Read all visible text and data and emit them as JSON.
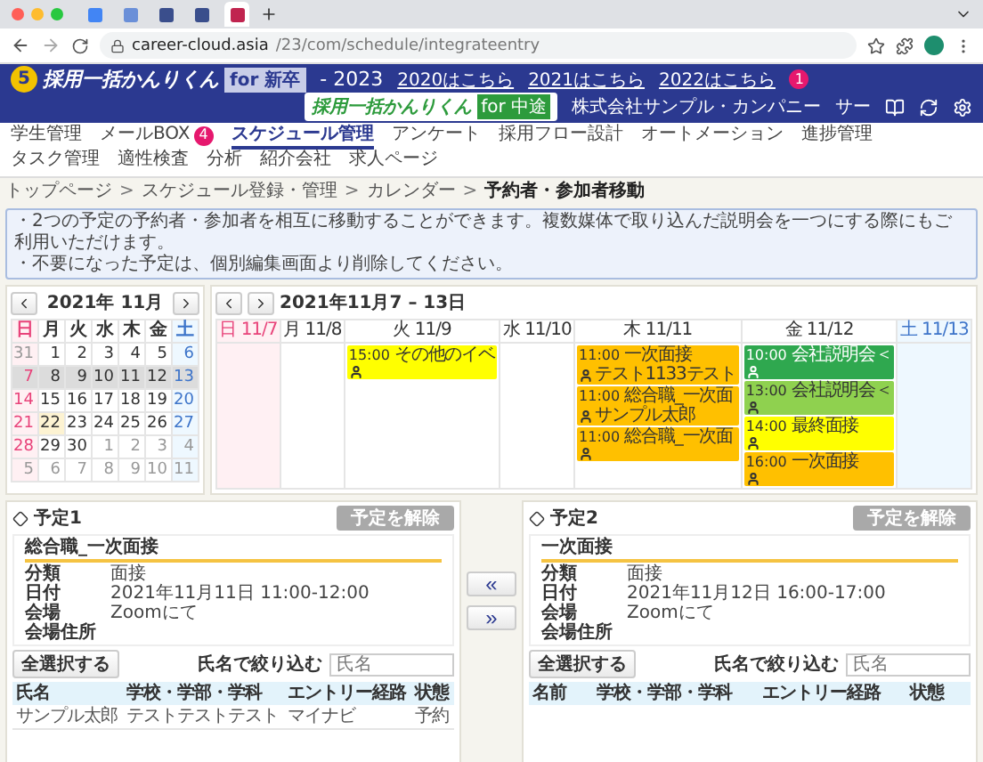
{
  "browser": {
    "tabs": [
      {
        "selected": false
      },
      {
        "selected": false
      },
      {
        "selected": false
      },
      {
        "selected": false
      },
      {
        "selected": true
      }
    ],
    "url_host": "career-cloud.asia",
    "url_path": "/23/com/schedule/integrateentry"
  },
  "header": {
    "logo_badge": "5",
    "logo": "採用一括かんりくん",
    "logo_tag": "for 新卒",
    "year": "- 2023",
    "links": [
      "2020はこちら",
      "2021はこちら",
      "2022はこちら"
    ],
    "links_badge": "1",
    "logo2": "採用一括かんりくん",
    "logo2_tag": "for 中途",
    "company": "株式会社サンプル・カンパニー",
    "user": "サー"
  },
  "nav": {
    "items": [
      {
        "label": "学生管理",
        "selected": false
      },
      {
        "label": "メールBOX",
        "selected": false,
        "badge": "4"
      },
      {
        "label": "スケジュール管理",
        "selected": true
      },
      {
        "label": "アンケート",
        "selected": false
      },
      {
        "label": "採用フロー設計",
        "selected": false
      },
      {
        "label": "オートメーション",
        "selected": false
      },
      {
        "label": "進捗管理",
        "selected": false
      },
      {
        "label": "タスク管理",
        "selected": false
      },
      {
        "label": "適性検査",
        "selected": false
      },
      {
        "label": "分析",
        "selected": false
      },
      {
        "label": "紹介会社",
        "selected": false
      },
      {
        "label": "求人ページ",
        "selected": false
      }
    ]
  },
  "breadcrumb": {
    "separator": ">",
    "items": [
      "トップページ",
      "スケジュール登録・管理",
      "カレンダー",
      "予約者・参加者移動"
    ]
  },
  "notice": [
    "・2つの予定の予約者・参加者を相互に移動することができます。複数媒体で取り込んだ説明会を一つにする際にもご利用いただけます。",
    "・不要になった予定は、個別編集画面より削除してください。"
  ],
  "month_calendar": {
    "title": "2021年 11月",
    "weekdays": [
      {
        "label": "日",
        "kind": "sunday"
      },
      {
        "label": "月",
        "kind": "weekday"
      },
      {
        "label": "火",
        "kind": "weekday"
      },
      {
        "label": "水",
        "kind": "weekday"
      },
      {
        "label": "木",
        "kind": "weekday"
      },
      {
        "label": "金",
        "kind": "weekday"
      },
      {
        "label": "土",
        "kind": "saturday"
      }
    ],
    "weeks": [
      {
        "selected": false,
        "days": [
          {
            "day": "31",
            "other_month": true,
            "today": false
          },
          {
            "day": "1",
            "other_month": false,
            "today": false
          },
          {
            "day": "2",
            "other_month": false,
            "today": false
          },
          {
            "day": "3",
            "other_month": false,
            "today": false
          },
          {
            "day": "4",
            "other_month": false,
            "today": false
          },
          {
            "day": "5",
            "other_month": false,
            "today": false
          },
          {
            "day": "6",
            "other_month": false,
            "today": false
          }
        ]
      },
      {
        "selected": true,
        "days": [
          {
            "day": "7",
            "other_month": false,
            "today": false
          },
          {
            "day": "8",
            "other_month": false,
            "today": false
          },
          {
            "day": "9",
            "other_month": false,
            "today": false
          },
          {
            "day": "10",
            "other_month": false,
            "today": false
          },
          {
            "day": "11",
            "other_month": false,
            "today": false
          },
          {
            "day": "12",
            "other_month": false,
            "today": false
          },
          {
            "day": "13",
            "other_month": false,
            "today": false
          }
        ]
      },
      {
        "selected": false,
        "days": [
          {
            "day": "14",
            "other_month": false,
            "today": false
          },
          {
            "day": "15",
            "other_month": false,
            "today": false
          },
          {
            "day": "16",
            "other_month": false,
            "today": false
          },
          {
            "day": "17",
            "other_month": false,
            "today": false
          },
          {
            "day": "18",
            "other_month": false,
            "today": false
          },
          {
            "day": "19",
            "other_month": false,
            "today": false
          },
          {
            "day": "20",
            "other_month": false,
            "today": false
          }
        ]
      },
      {
        "selected": false,
        "days": [
          {
            "day": "21",
            "other_month": false,
            "today": false
          },
          {
            "day": "22",
            "other_month": false,
            "today": true
          },
          {
            "day": "23",
            "other_month": false,
            "today": false
          },
          {
            "day": "24",
            "other_month": false,
            "today": false
          },
          {
            "day": "25",
            "other_month": false,
            "today": false
          },
          {
            "day": "26",
            "other_month": false,
            "today": false
          },
          {
            "day": "27",
            "other_month": false,
            "today": false
          }
        ]
      },
      {
        "selected": false,
        "days": [
          {
            "day": "28",
            "other_month": false,
            "today": false
          },
          {
            "day": "29",
            "other_month": false,
            "today": false
          },
          {
            "day": "30",
            "other_month": false,
            "today": false
          },
          {
            "day": "1",
            "other_month": true,
            "today": false
          },
          {
            "day": "2",
            "other_month": true,
            "today": false
          },
          {
            "day": "3",
            "other_month": true,
            "today": false
          },
          {
            "day": "4",
            "other_month": true,
            "today": false
          }
        ]
      },
      {
        "selected": false,
        "days": [
          {
            "day": "5",
            "other_month": true,
            "today": false
          },
          {
            "day": "6",
            "other_month": true,
            "today": false
          },
          {
            "day": "7",
            "other_month": true,
            "today": false
          },
          {
            "day": "8",
            "other_month": true,
            "today": false
          },
          {
            "day": "9",
            "other_month": true,
            "today": false
          },
          {
            "day": "10",
            "other_month": true,
            "today": false
          },
          {
            "day": "11",
            "other_month": true,
            "today": false
          }
        ]
      }
    ]
  },
  "week_calendar": {
    "title": "2021年11月7 – 13日",
    "days": [
      {
        "label": "日 11/7",
        "kind": "sunday"
      },
      {
        "label": "月 11/8",
        "kind": "weekday"
      },
      {
        "label": "火 11/9",
        "kind": "weekday",
        "events": [
          {
            "time": "15:00",
            "title": "その他のイベ",
            "color": "#ffff00"
          }
        ]
      },
      {
        "label": "水 11/10",
        "kind": "weekday"
      },
      {
        "label": "木 11/11",
        "kind": "weekday",
        "events": [
          {
            "time": "11:00",
            "title": "一次面接",
            "attendee": "テスト1133テスト",
            "color": "#ffc000"
          },
          {
            "time": "11:00",
            "title": "総合職_一次面",
            "attendee": "サンプル太郎",
            "color": "#ffc000"
          },
          {
            "time": "11:00",
            "title": "総合職_一次面",
            "color": "#ffc000"
          }
        ]
      },
      {
        "label": "金 11/12",
        "kind": "weekday",
        "events": [
          {
            "time": "10:00",
            "title": "会社説明会＜",
            "color": "#2fa84f"
          },
          {
            "time": "13:00",
            "title": "会社説明会＜",
            "color": "#8fd14f"
          },
          {
            "time": "14:00",
            "title": "最終面接",
            "color": "#ffff00"
          },
          {
            "time": "16:00",
            "title": "一次面接",
            "color": "#ffc000"
          }
        ]
      },
      {
        "label": "土 11/13",
        "kind": "saturday"
      }
    ]
  },
  "schedules": [
    {
      "label": "予定1",
      "release_button": "予定を解除",
      "event_title": "総合職_一次面接",
      "fields": [
        {
          "label": "分類",
          "value": "面接"
        },
        {
          "label": "日付",
          "value": "2021年11月11日 11:00-12:00"
        },
        {
          "label": "会場",
          "value": "Zoomにて"
        },
        {
          "label": "会場住所"
        }
      ],
      "select_all": "全選択する",
      "filter_label": "氏名で絞り込む",
      "filter_placeholder": "氏名",
      "columns": [
        "氏名",
        "学校・学部・学科",
        "エントリー経路",
        "状態"
      ],
      "rows": [
        [
          "サンプル太郎",
          "テストテストテスト",
          "マイナビ",
          "予約"
        ]
      ]
    },
    {
      "label": "予定2",
      "release_button": "予定を解除",
      "event_title": "一次面接",
      "fields": [
        {
          "label": "分類",
          "value": "面接"
        },
        {
          "label": "日付",
          "value": "2021年11月12日 16:00-17:00"
        },
        {
          "label": "会場",
          "value": "Zoomにて"
        },
        {
          "label": "会場住所"
        }
      ],
      "select_all": "全選択する",
      "filter_label": "氏名で絞り込む",
      "filter_placeholder": "氏名",
      "columns": [
        "名前",
        "学校・学部・学科",
        "エントリー経路",
        "状態"
      ]
    }
  ],
  "move_buttons": [
    "«",
    "»"
  ]
}
